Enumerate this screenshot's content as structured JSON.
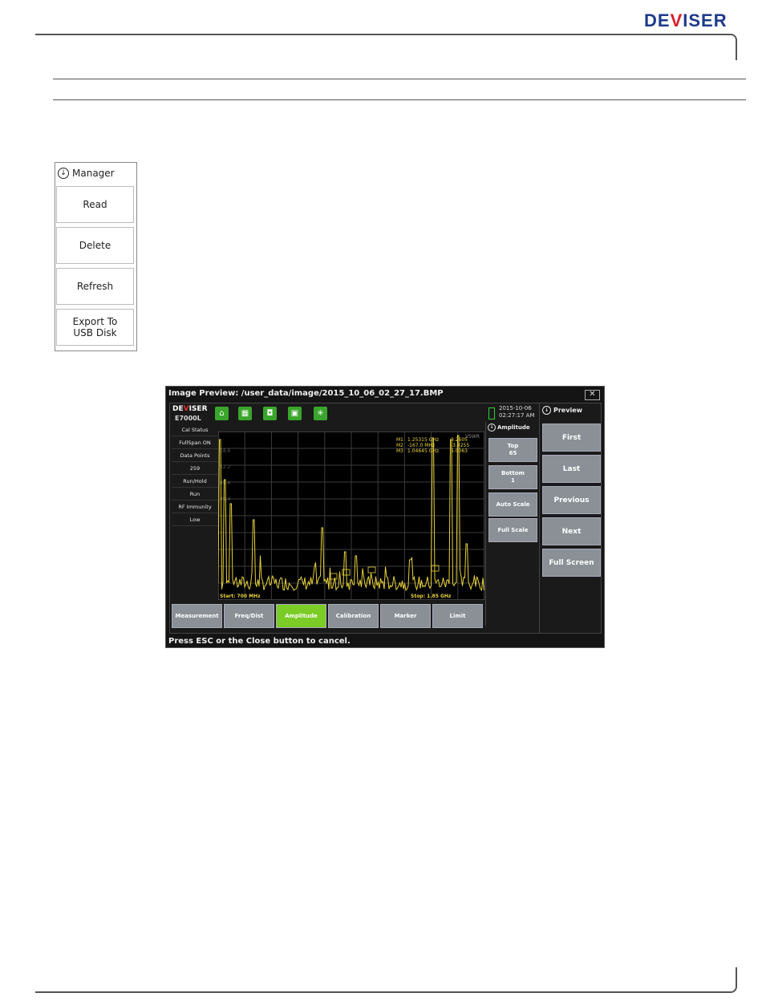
{
  "brand": {
    "pre": "DE",
    "v": "V",
    "post": "ISER"
  },
  "manager": {
    "title": "Manager",
    "buttons": [
      "Read",
      "Delete",
      "Refresh",
      "Export To\nUSB Disk"
    ]
  },
  "preview_window": {
    "title": "Image Preview:  /user_data/image/2015_10_06_02_27_17.BMP",
    "close": "✕",
    "status": "Press ESC or the Close button to cancel."
  },
  "device": {
    "logo": {
      "pre": "DE",
      "v": "V",
      "post": "ISER"
    },
    "model": "E7000L",
    "toolbar_icons": [
      "home-icon",
      "grid-icon",
      "camera-icon",
      "save-icon",
      "sun-icon"
    ],
    "toolbar_glyphs": [
      "⌂",
      "▦",
      "◘",
      "▣",
      "✳"
    ],
    "datetime": "2015-10-06\n02:27:17 AM",
    "info": [
      "Cal Status",
      "FullSpan ON",
      "Data Points",
      "259",
      "Run/Hold",
      "Run",
      "RF Immunity",
      "Low"
    ],
    "amplitude_title": "Amplitude",
    "amplitude_buttons": [
      "Top\n65",
      "Bottom\n1",
      "Auto Scale",
      "Full Scale"
    ],
    "softkeys": [
      "Measurement",
      "Freq/Dist",
      "Amplitude",
      "Calibration",
      "Marker",
      "Limit"
    ],
    "active_softkey": "Amplitude"
  },
  "preview_panel": {
    "title": "Preview",
    "buttons": [
      "First",
      "Last",
      "Previous",
      "Next",
      "Full Screen"
    ]
  },
  "chart_data": {
    "type": "line",
    "title": "VSWR",
    "x_start": "Start: 700 MHz",
    "x_stop": "Stop: 1.85 GHz",
    "ylim": [
      1,
      65
    ],
    "grid": true,
    "markers": [
      {
        "name": "M1",
        "freq": "1.25315 GHz",
        "value": "3.2605"
      },
      {
        "name": "M2",
        "freq": "-167.0 MHz",
        "value": "-3.4255"
      },
      {
        "name": "M3",
        "freq": "1.04645 GHz",
        "value": "5.0063"
      }
    ],
    "y_tick_labels": [
      "58.6",
      "52.2",
      "45.8",
      "39.4"
    ],
    "line_color": "#e8d23a"
  }
}
